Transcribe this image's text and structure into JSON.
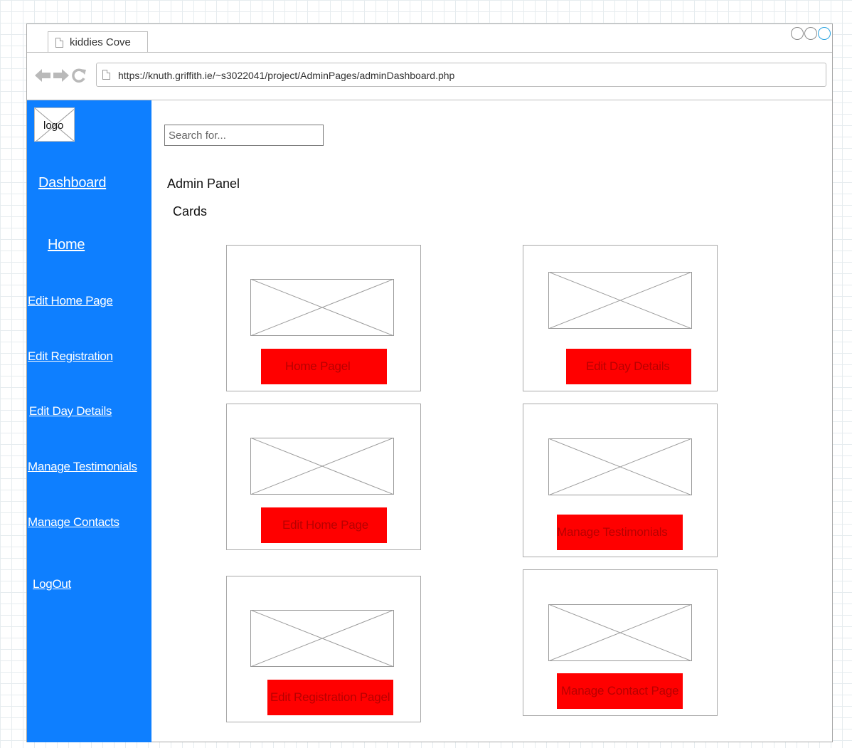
{
  "browser": {
    "tab_title": "kiddies Cove",
    "url": "https://knuth.griffith.ie/~s3022041/project/AdminPages/adminDashboard.php",
    "nav_icons": [
      "back-arrow-icon",
      "forward-arrow-icon",
      "reload-icon"
    ]
  },
  "sidebar": {
    "logo_text": "logo",
    "color": "#0e7fff",
    "links": [
      {
        "label": "Dashboard"
      },
      {
        "label": "Home"
      },
      {
        "label": "Edit Home Page"
      },
      {
        "label": "Edit Registration"
      },
      {
        "label": "Edit Day Details"
      },
      {
        "label": "Manage Testimonials"
      },
      {
        "label": "Manage Contacts"
      },
      {
        "label": "LogOut"
      }
    ]
  },
  "main": {
    "search_placeholder": "Search for...",
    "title": "Admin Panel",
    "subtitle": "Cards",
    "button_color": "#ff0000",
    "cards": [
      {
        "button_label": "Home Pagel"
      },
      {
        "button_label": "Edit Day Details"
      },
      {
        "button_label": "Edit Home Page"
      },
      {
        "button_label": "Manage Testimonials"
      },
      {
        "button_label": "Edit Registration Pagel"
      },
      {
        "button_label": "Manage Contact Page"
      }
    ]
  }
}
